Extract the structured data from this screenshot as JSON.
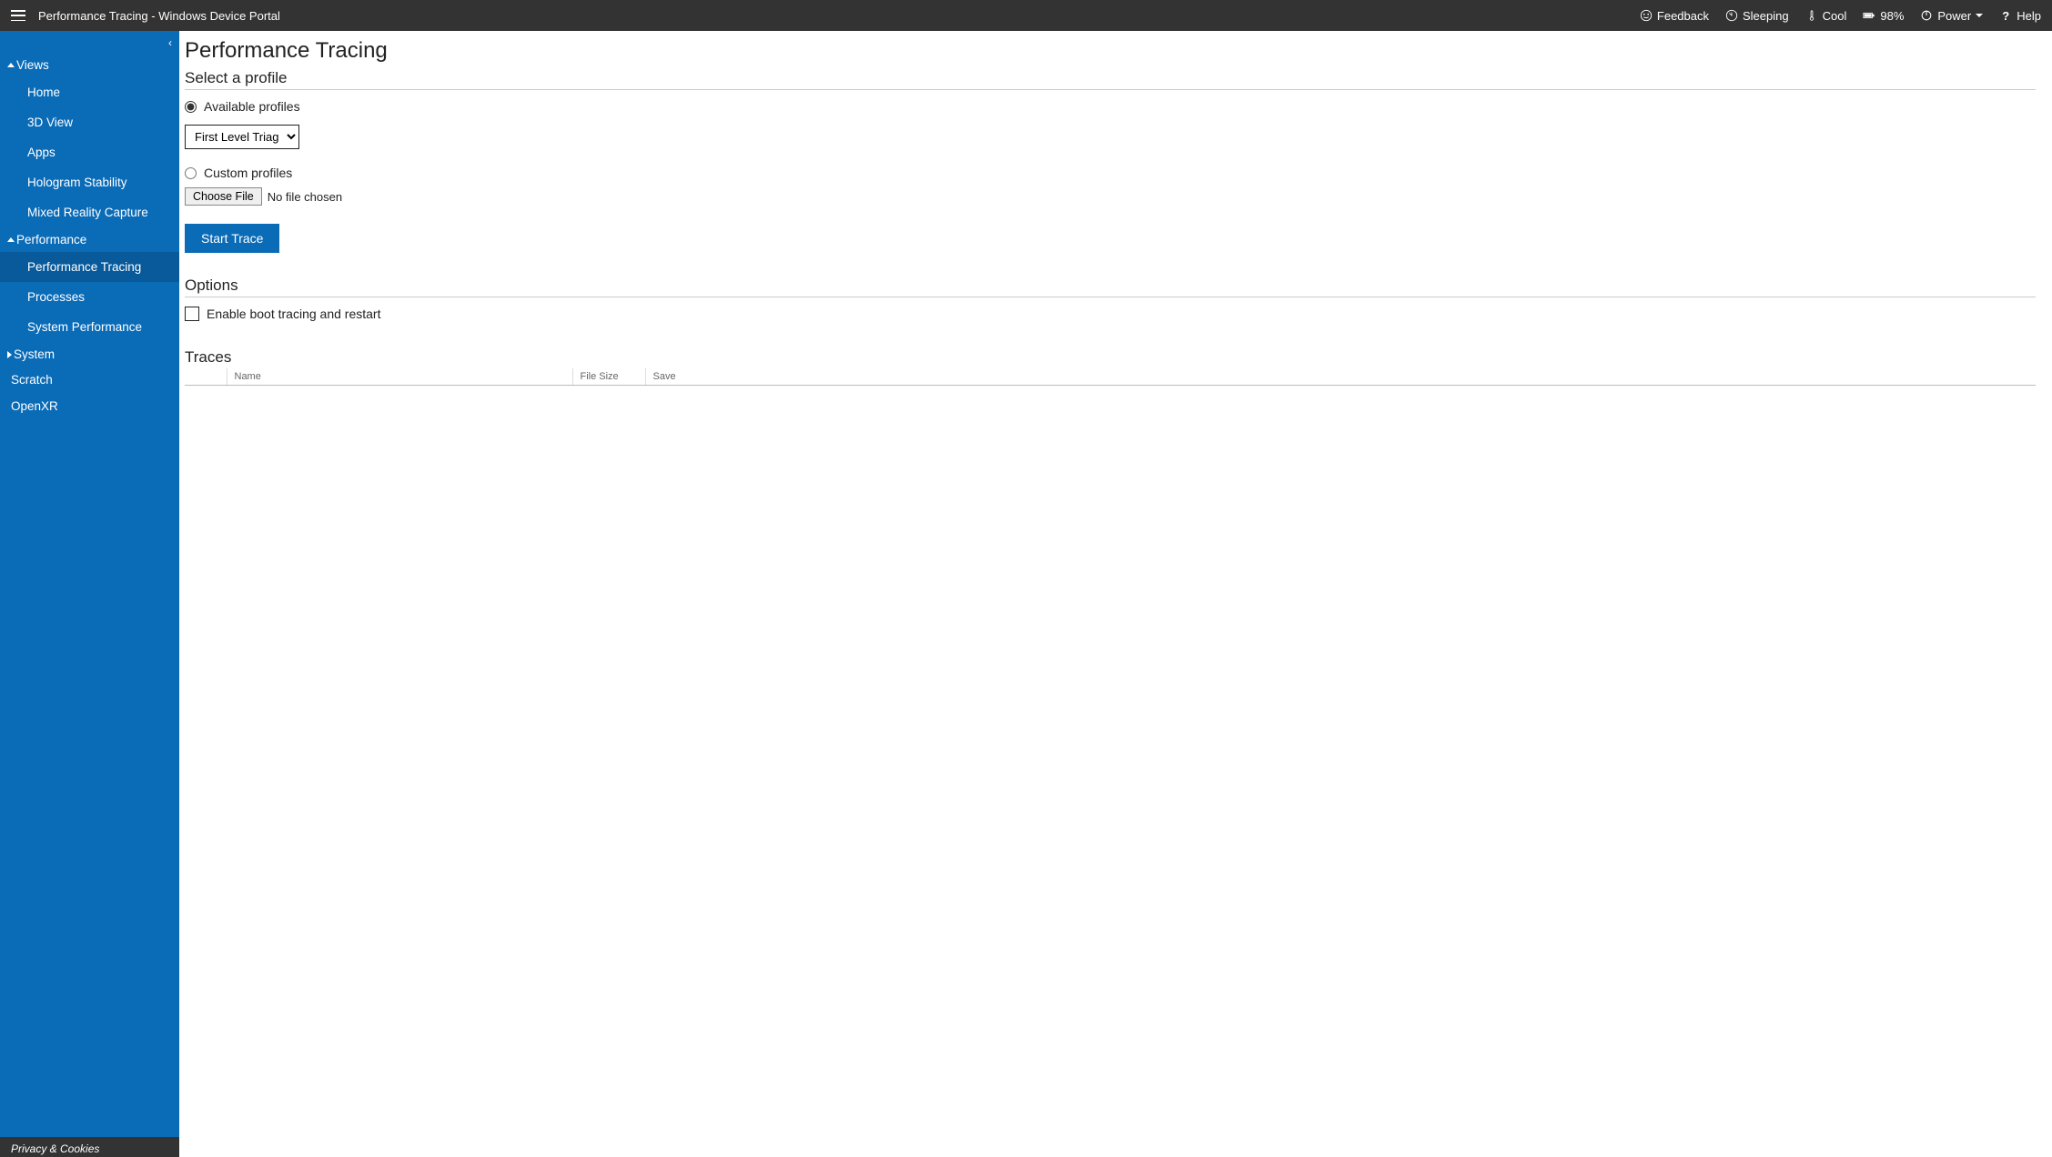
{
  "header": {
    "title": "Performance Tracing - Windows Device Portal",
    "feedback": "Feedback",
    "sleeping": "Sleeping",
    "cool": "Cool",
    "battery": "98%",
    "power": "Power",
    "help": "Help"
  },
  "sidebar": {
    "groups": [
      {
        "label": "Views",
        "expanded": true,
        "items": [
          "Home",
          "3D View",
          "Apps",
          "Hologram Stability",
          "Mixed Reality Capture"
        ]
      },
      {
        "label": "Performance",
        "expanded": true,
        "items": [
          "Performance Tracing",
          "Processes",
          "System Performance"
        ],
        "activeIndex": 0
      },
      {
        "label": "System",
        "expanded": false,
        "items": []
      }
    ],
    "topItems": [
      "Scratch",
      "OpenXR"
    ],
    "footer": "Privacy & Cookies"
  },
  "main": {
    "pageTitle": "Performance Tracing",
    "section1": "Select a profile",
    "availableProfiles": "Available profiles",
    "profileSelected": "First Level Triage",
    "customProfiles": "Custom profiles",
    "chooseFile": "Choose File",
    "noFile": "No file chosen",
    "startTrace": "Start Trace",
    "section2": "Options",
    "bootTracing": "Enable boot tracing and restart",
    "section3": "Traces",
    "tableHeaders": {
      "name": "Name",
      "size": "File Size",
      "save": "Save"
    }
  }
}
